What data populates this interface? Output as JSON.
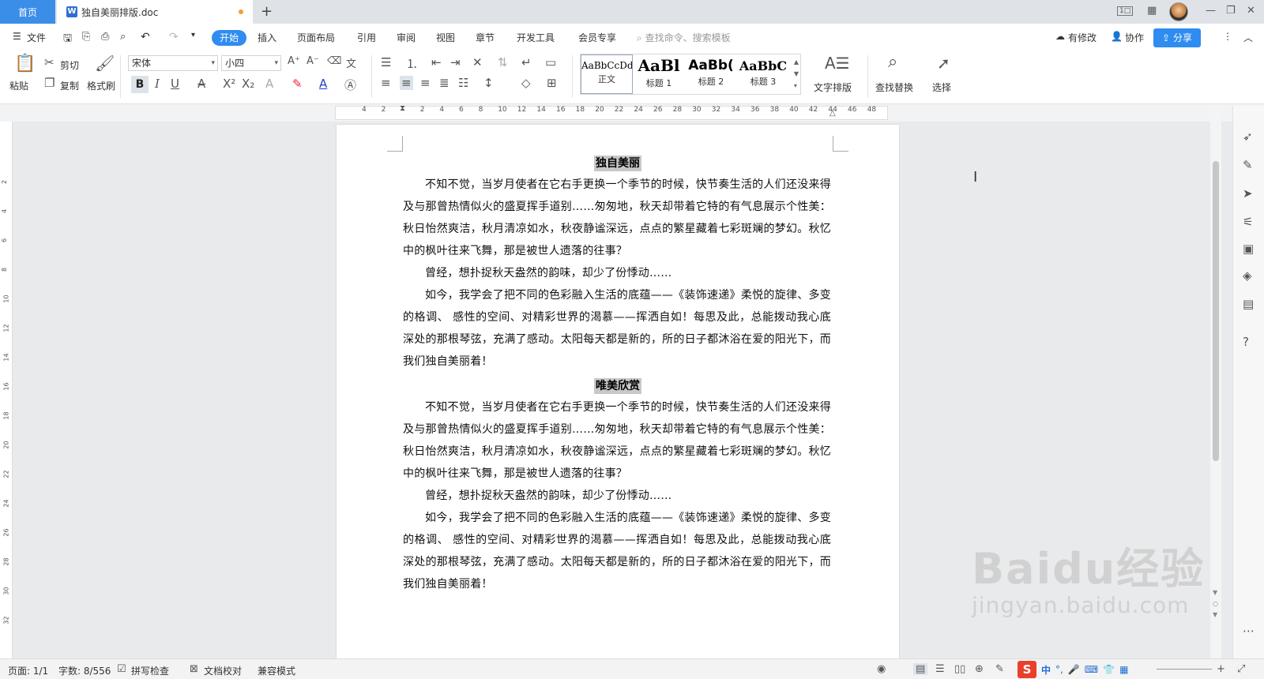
{
  "titlebar": {
    "home_tab": "首页",
    "doc_tab": "独自美丽排版.doc",
    "new_tab": "+",
    "layout_badge": "1□"
  },
  "menubar": {
    "file": "文件",
    "tabs": [
      "开始",
      "插入",
      "页面布局",
      "引用",
      "审阅",
      "视图",
      "章节",
      "开发工具",
      "会员专享"
    ],
    "search_placeholder": "查找命令、搜索模板",
    "has_changes": "有修改",
    "collab": "协作",
    "share": "分享"
  },
  "ribbon": {
    "paste": "粘贴",
    "cut": "剪切",
    "copy": "复制",
    "format_painter": "格式刷",
    "font_name": "宋体",
    "font_size": "小四",
    "styles": [
      {
        "sample": "AaBbCcDd",
        "name": "正文"
      },
      {
        "sample": "AaBl",
        "name": "标题 1"
      },
      {
        "sample": "AaBb(",
        "name": "标题 2"
      },
      {
        "sample": "AaBbC",
        "name": "标题 3"
      }
    ],
    "text_layout": "文字排版",
    "find_replace": "查找替换",
    "select": "选择"
  },
  "ruler": {
    "ticks": [
      "4",
      "2",
      "",
      "2",
      "4",
      "6",
      "8",
      "10",
      "12",
      "14",
      "16",
      "18",
      "20",
      "22",
      "24",
      "26",
      "28",
      "30",
      "32",
      "34",
      "36",
      "38",
      "40",
      "42",
      "44",
      "46",
      "48"
    ]
  },
  "vruler": {
    "ticks": [
      "2",
      "4",
      "6",
      "8",
      "10",
      "12",
      "14",
      "16",
      "18",
      "20",
      "22",
      "24",
      "26",
      "28",
      "30",
      "32"
    ]
  },
  "document": {
    "sections": [
      {
        "heading": "独自美丽",
        "paragraphs": [
          "不知不觉，当岁月使者在它右手更换一个季节的时候，快节奏生活的人们还没来得及与那曾热情似火的盛夏挥手道别……匆匆地，秋天却带着它特的有气息展示个性美：秋日怡然爽洁，秋月清凉如水，秋夜静谧深远，点点的繁星藏着七彩斑斓的梦幻。秋忆中的枫叶往来飞舞，那是被世人遗落的往事？",
          "曾经，想扑捉秋天盎然的韵味，却少了份悸动……",
          "如今，我学会了把不同的色彩融入生活的底蕴——《装饰速递》柔悦的旋律、多变的格调、  感性的空间、对精彩世界的渴慕——挥洒自如！每思及此，总能拨动我心底深处的那根琴弦，充满了感动。太阳每天都是新的，所的日子都沐浴在爱的阳光下，而我们独自美丽着！"
        ]
      },
      {
        "heading": "唯美欣赏",
        "paragraphs": [
          "不知不觉，当岁月使者在它右手更换一个季节的时候，快节奏生活的人们还没来得及与那曾热情似火的盛夏挥手道别……匆匆地，秋天却带着它特的有气息展示个性美：秋日怡然爽洁，秋月清凉如水，秋夜静谧深远，点点的繁星藏着七彩斑斓的梦幻。秋忆中的枫叶往来飞舞，那是被世人遗落的往事？",
          "曾经，想扑捉秋天盎然的韵味，却少了份悸动……",
          "如今，我学会了把不同的色彩融入生活的底蕴——《装饰速递》柔悦的旋律、多变的格调、  感性的空间、对精彩世界的渴慕——挥洒自如！每思及此，总能拨动我心底深处的那根琴弦，充满了感动。太阳每天都是新的，所的日子都沐浴在爱的阳光下，而我们独自美丽着！"
        ]
      }
    ]
  },
  "statusbar": {
    "page": "页面: 1/1",
    "word_count": "字数: 8/556",
    "spell_check": "拼写检查",
    "doc_proof": "文档校对",
    "compat_mode": "兼容模式",
    "ime_lang": "中"
  },
  "watermark": {
    "brand": "Baidu经验",
    "url": "jingyan.baidu.com"
  },
  "colors": {
    "accent": "#2f8cf0",
    "home_tab": "#3b8ee8",
    "heading_highlight": "#c8c8c8",
    "ime": "#e8402b"
  }
}
